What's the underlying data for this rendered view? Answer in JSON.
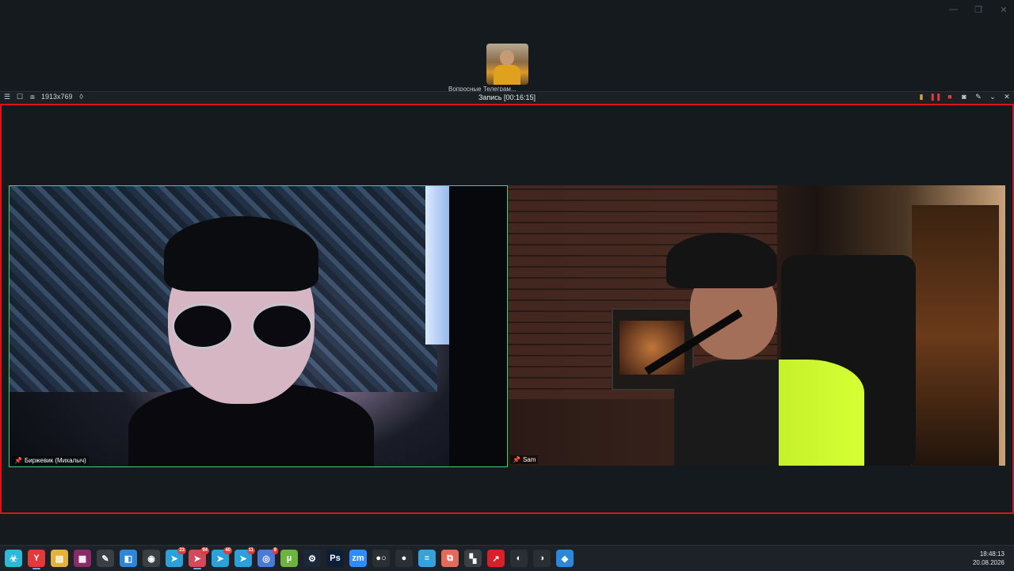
{
  "window_controls": {
    "minimize": "—",
    "restore": "❐",
    "close": "✕"
  },
  "thumbnail": {
    "name": "Вопросные Телеграм..."
  },
  "record_bar": {
    "resolution": "1913x769",
    "title": "Запись [00:16:15]"
  },
  "tiles": [
    {
      "name": "Биржевик (Михалыч)"
    },
    {
      "name": "Sam"
    }
  ],
  "taskbar": {
    "icons": [
      {
        "name": "biohazard-icon",
        "glyph": "☣",
        "color": "#2fb8d8",
        "badge": ""
      },
      {
        "name": "yandex-browser-icon",
        "glyph": "Y",
        "color": "#e23a3a",
        "badge": ""
      },
      {
        "name": "file-explorer-icon",
        "glyph": "▤",
        "color": "#e3b23c",
        "badge": ""
      },
      {
        "name": "winrar-icon",
        "glyph": "▦",
        "color": "#8b2a6a",
        "badge": ""
      },
      {
        "name": "paint-icon",
        "glyph": "✎",
        "color": "#3a3f44",
        "badge": ""
      },
      {
        "name": "store-icon",
        "glyph": "◧",
        "color": "#2b88d8",
        "badge": ""
      },
      {
        "name": "tor-icon",
        "glyph": "◉",
        "color": "#3a3f44",
        "badge": ""
      },
      {
        "name": "telegram-icon",
        "glyph": "➤",
        "color": "#2aa1da",
        "badge": "23"
      },
      {
        "name": "telegram-red-icon",
        "glyph": "➤",
        "color": "#d04a5a",
        "badge": "94"
      },
      {
        "name": "telegram-2-icon",
        "glyph": "➤",
        "color": "#2aa1da",
        "badge": "40"
      },
      {
        "name": "telegram-3-icon",
        "glyph": "➤",
        "color": "#2aa1da",
        "badge": "11"
      },
      {
        "name": "chrome-icon",
        "glyph": "◎",
        "color": "#4a7ad8",
        "badge": "9"
      },
      {
        "name": "utorrent-icon",
        "glyph": "µ",
        "color": "#6cb33f",
        "badge": ""
      },
      {
        "name": "steam-icon",
        "glyph": "⚙",
        "color": "#1b2838",
        "badge": ""
      },
      {
        "name": "photoshop-icon",
        "glyph": "Ps",
        "color": "#0b1e3a",
        "badge": ""
      },
      {
        "name": "zoom-icon",
        "glyph": "zm",
        "color": "#2d8cff",
        "badge": ""
      },
      {
        "name": "obs-dots-icon",
        "glyph": "●○",
        "color": "#2a2f34",
        "badge": ""
      },
      {
        "name": "record-icon",
        "glyph": "●",
        "color": "#2a2f34",
        "badge": ""
      },
      {
        "name": "notes-icon",
        "glyph": "≡",
        "color": "#3aa0d8",
        "badge": ""
      },
      {
        "name": "screenshot-icon",
        "glyph": "⧉",
        "color": "#e36a5a",
        "badge": ""
      },
      {
        "name": "grid-app-icon",
        "glyph": "▚",
        "color": "#3a3f44",
        "badge": ""
      },
      {
        "name": "arrow-app-icon",
        "glyph": "↗",
        "color": "#d8202a",
        "badge": ""
      },
      {
        "name": "obs-icon",
        "glyph": "◐",
        "color": "#2a2f34",
        "badge": ""
      },
      {
        "name": "obs-2-icon",
        "glyph": "◑",
        "color": "#2a2f34",
        "badge": ""
      },
      {
        "name": "paint-3d-icon",
        "glyph": "◆",
        "color": "#2b88d8",
        "badge": ""
      }
    ]
  },
  "clock": {
    "time": "18:48:13",
    "date": "20.08.2026"
  }
}
